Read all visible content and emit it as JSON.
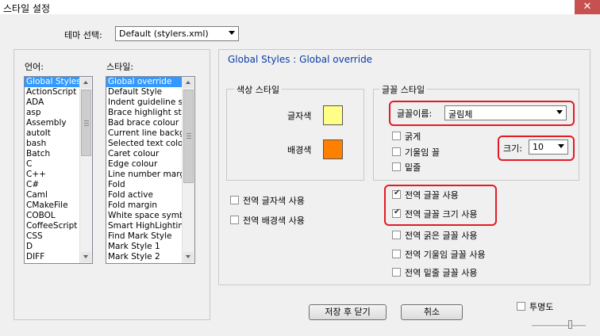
{
  "window": {
    "title": "스타일 설정",
    "close": "✕"
  },
  "theme": {
    "label": "테마 선택:",
    "value": "Default (stylers.xml)"
  },
  "language": {
    "label": "언어:",
    "items": [
      "Global Styles",
      "ActionScript",
      "ADA",
      "asp",
      "Assembly",
      "autoIt",
      "bash",
      "Batch",
      "C",
      "C++",
      "C#",
      "Caml",
      "CMakeFile",
      "COBOL",
      "CoffeeScript",
      "CSS",
      "D",
      "DIFF"
    ],
    "selected": "Global Styles"
  },
  "style": {
    "label": "스타일:",
    "items": [
      "Global override",
      "Default Style",
      "Indent guideline style",
      "Brace highlight style",
      "Bad brace colour",
      "Current line background colour",
      "Selected text colour",
      "Caret colour",
      "Edge colour",
      "Line number margin",
      "Fold",
      "Fold active",
      "Fold margin",
      "White space symbol",
      "Smart HighLighting",
      "Find Mark Style",
      "Mark Style 1",
      "Mark Style 2"
    ],
    "selected": "Global override"
  },
  "header": "Global Styles : Global override",
  "colors": {
    "group_label": "색상 스타일",
    "fg_label": "글자색",
    "bg_label": "배경색",
    "fg_color": "#ffff88",
    "bg_color": "#ff8000"
  },
  "font": {
    "group_label": "글꼴 스타일",
    "name_label": "글꼴이름:",
    "name_value": "굴림체",
    "size_label": "크기:",
    "size_value": "10",
    "bold": "굵게",
    "italic": "기울임 꼴",
    "underline": "밑줄"
  },
  "options": {
    "global_fg": "전역 글자색 사용",
    "global_bg": "전역 배경색 사용",
    "global_font": "전역 글꼴 사용",
    "global_size": "전역 글꼴 크기 사용",
    "global_bold": "전역 굵은 글꼴 사용",
    "global_italic": "전역 기울임 글꼴 사용",
    "global_underline": "전역 밑줄 글꼴 사용"
  },
  "buttons": {
    "save_close": "저장 후 닫기",
    "cancel": "취소"
  },
  "transparency": {
    "label": "투명도"
  }
}
